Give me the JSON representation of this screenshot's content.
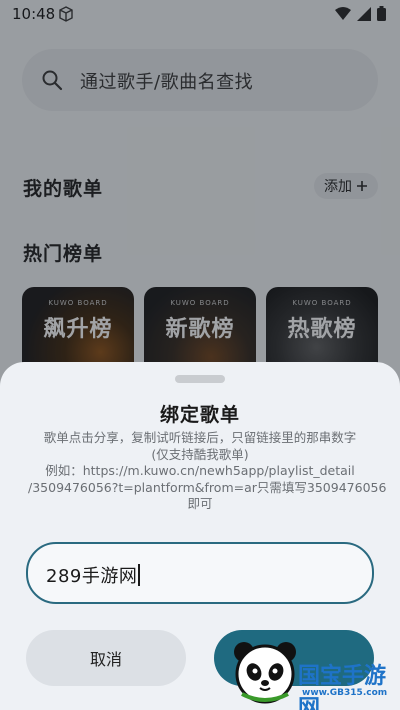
{
  "status_bar": {
    "time": "10:48",
    "icons": [
      "box-icon",
      "wifi-icon",
      "signal-icon",
      "battery-icon"
    ]
  },
  "search": {
    "placeholder": "通过歌手/歌曲名查找"
  },
  "my_playlists": {
    "title": "我的歌单",
    "add_label": "添加"
  },
  "hot_charts": {
    "title": "热门榜单",
    "cards": [
      {
        "brand": "KUWO BOARD",
        "title": "飙升榜"
      },
      {
        "brand": "KUWO BOARD",
        "title": "新歌榜"
      },
      {
        "brand": "KUWO BOARD",
        "title": "热歌榜"
      }
    ]
  },
  "bind_dialog": {
    "title": "绑定歌单",
    "desc_lines": [
      "歌单点击分享，复制试听链接后，只留链接里的那串数字",
      "(仅支持酷我歌单)",
      "例如：https://m.kuwo.cn/newh5app/playlist_detail",
      "/3509476056?t=plantform&from=ar只需填写3509476056",
      "即可"
    ],
    "input_value": "289手游网",
    "cancel_label": "取消",
    "confirm_label": ""
  },
  "watermark": {
    "brand": "国宝手游网",
    "url": "www.GB315.com"
  },
  "colors": {
    "accent": "#1f6a80",
    "watermark": "#1e73c8"
  }
}
